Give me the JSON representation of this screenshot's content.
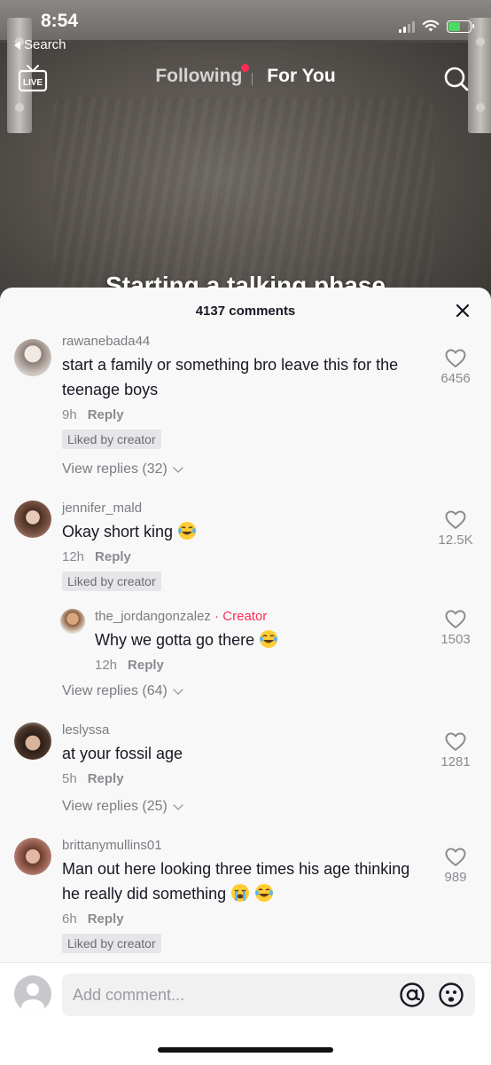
{
  "status_bar": {
    "time": "8:54",
    "back_label": "Search"
  },
  "top_nav": {
    "live_label": "LIVE",
    "tabs": [
      {
        "label": "Following",
        "has_dot": true
      },
      {
        "label": "For You",
        "active": true
      }
    ]
  },
  "video": {
    "caption_peek": "Starting a talking phase"
  },
  "comments_sheet": {
    "count_label": "4137 comments",
    "comments": [
      {
        "username": "rawanebada44",
        "text": "start a family or something bro leave this for the teenage boys",
        "time": "9h",
        "reply_label": "Reply",
        "badge": "Liked by creator",
        "likes": "6456",
        "view_replies": "View replies (32)"
      },
      {
        "username": "jennifer_mald",
        "text": "Okay short king",
        "emoji": [
          "laughing-tears"
        ],
        "time": "12h",
        "reply_label": "Reply",
        "badge": "Liked by creator",
        "likes": "12.5K",
        "reply": {
          "username": "the_jordangonzalez",
          "creator_tag": "· Creator",
          "text": "Why we gotta go there",
          "emoji": [
            "laughing-tears"
          ],
          "time": "12h",
          "reply_label": "Reply",
          "likes": "1503"
        },
        "view_replies": "View replies (64)"
      },
      {
        "username": "leslyssa",
        "text": "at your fossil age",
        "time": "5h",
        "reply_label": "Reply",
        "likes": "1281",
        "view_replies": "View replies (25)"
      },
      {
        "username": "brittanymullins01",
        "text": "Man out here looking three times his age thinking he really did something",
        "emoji": [
          "loudly-crying",
          "laughing-tears"
        ],
        "time": "6h",
        "reply_label": "Reply",
        "badge": "Liked by creator",
        "likes": "989"
      }
    ]
  },
  "input": {
    "placeholder": "Add comment..."
  },
  "colors": {
    "accent": "#fe2c55",
    "sheet_bg": "#f8f8f8",
    "text_primary": "#161823",
    "text_muted": "#8a8b91"
  }
}
